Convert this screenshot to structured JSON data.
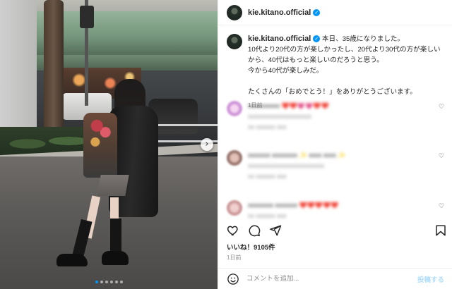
{
  "post": {
    "username": "kie.kitano.official",
    "verified_glyph": "✓",
    "caption_lines": [
      "本日、35歳になりました。",
      "10代より20代の方が楽しかったし、20代より30代の方が楽しい",
      "から、40代はもっと楽しいのだろうと思う。",
      "今から40代が楽しみだ。",
      "",
      "たくさんの「おめでとう！」をありがとうございます。"
    ],
    "caption_time": "1日前",
    "likes": "いいね！9105件",
    "time": "1日前"
  },
  "comments": [
    {
      "line1": "xxxxxxxxxx ❤️❤️💗💗❤️❤️",
      "line2": "xxxxxxxxxxxxxxxxxxxx",
      "line3": "xx xxxxxx xxx",
      "avatar_color": "#f2c6e8"
    },
    {
      "line1": "xxxxxxx xxxxxxxx ✨ xxxx xxxx ✨",
      "line2": "xxxxxxxxxxxxxxxxxxxxxxxx",
      "line3": "xx xxxxxx xxx",
      "avatar_color": "#b7908a"
    },
    {
      "line1": "xxxxxxxx xxxxxxx ❤️❤️❤️❤️❤️",
      "line2": "xx xxxxxx xxx",
      "line3": "",
      "avatar_color": "#d9a7a7"
    }
  ],
  "icons": {
    "like": "heart-icon",
    "comment": "comment-icon",
    "share": "share-icon",
    "save": "bookmark-icon",
    "emoji": "emoji-icon",
    "next": "chevron-right-icon"
  },
  "comment_bar": {
    "placeholder": "コメントを追加...",
    "post_label": "投稿する"
  },
  "carousel": {
    "count": 6,
    "active": 1,
    "next_glyph": "›"
  },
  "colors": {
    "accent": "#0095f6",
    "post_button": "#b2dffc",
    "muted_text": "#8e8e8e"
  }
}
